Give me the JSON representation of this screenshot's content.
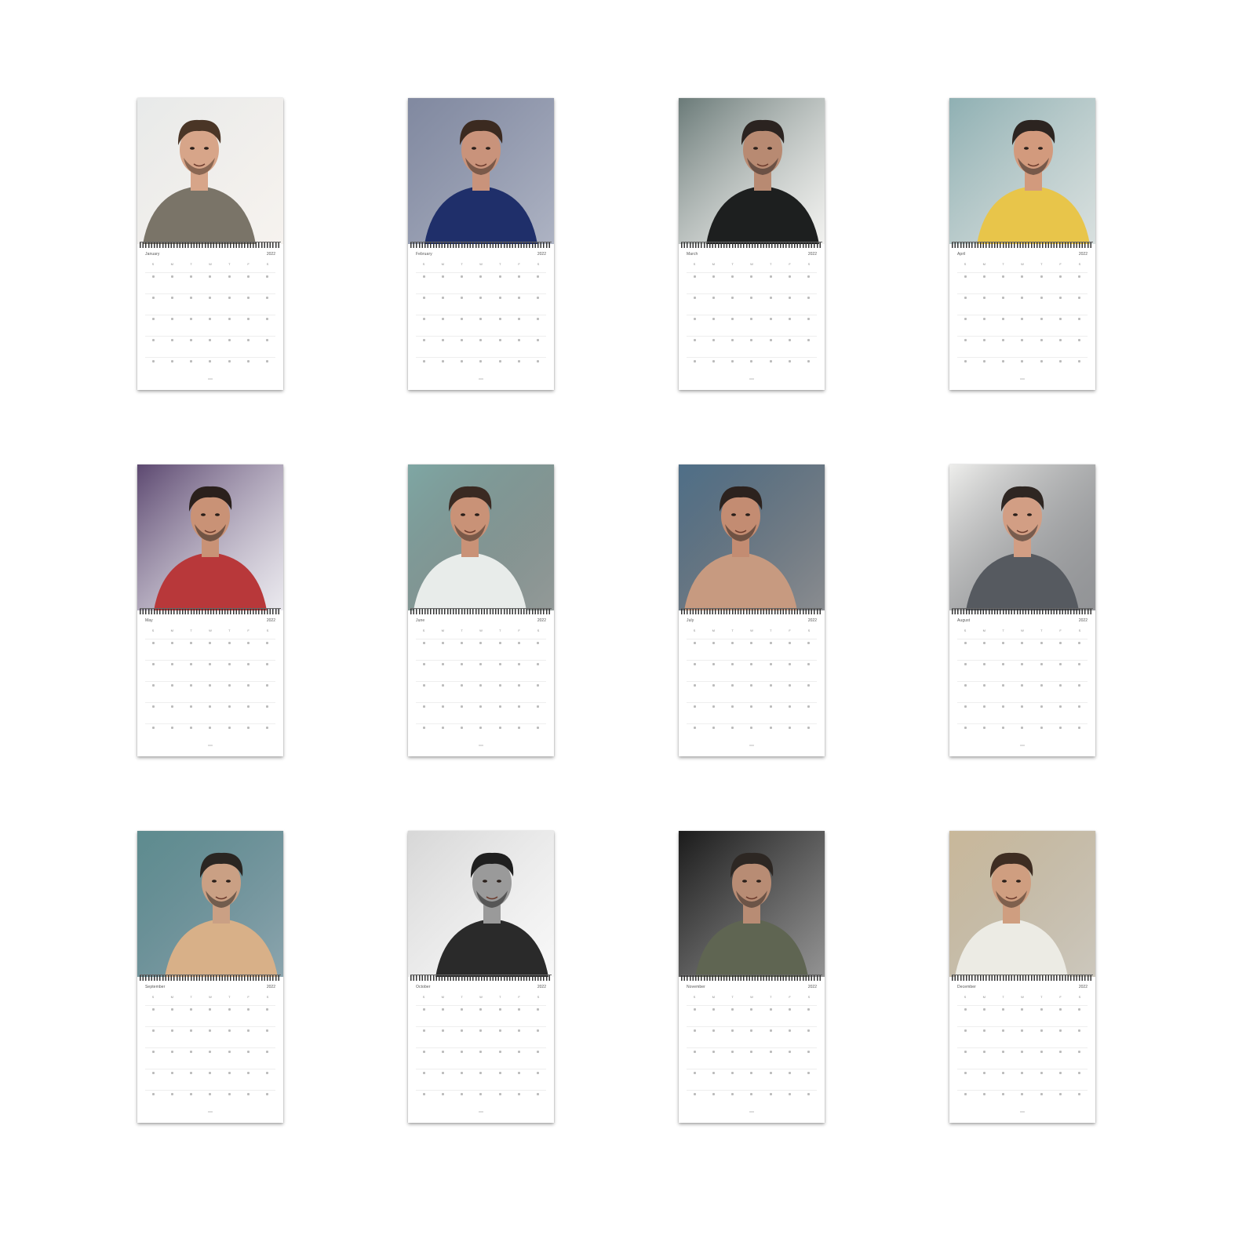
{
  "calendars": [
    {
      "month": "January",
      "year": "2022",
      "photo": {
        "bg": "#e8eaea",
        "shirt": "#7a7468",
        "skin": "#d7a589",
        "hair": "#4a3526",
        "accent": "#efe9e2"
      }
    },
    {
      "month": "February",
      "year": "2022",
      "photo": {
        "bg": "#8189a0",
        "shirt": "#1f2f6a",
        "skin": "#c9937b",
        "hair": "#3b2a20",
        "accent": "#6b7592"
      }
    },
    {
      "month": "March",
      "year": "2022",
      "photo": {
        "bg": "#6a7a78",
        "shirt": "#1d1f1f",
        "skin": "#b88a72",
        "hair": "#2b2320",
        "accent": "#e6e6e2"
      }
    },
    {
      "month": "April",
      "year": "2022",
      "photo": {
        "bg": "#8fb0b3",
        "shirt": "#e8c54a",
        "skin": "#d29a7d",
        "hair": "#2c2420",
        "accent": "#b8c6c4"
      }
    },
    {
      "month": "May",
      "year": "2022",
      "photo": {
        "bg": "#5c4870",
        "shirt": "#b8383a",
        "skin": "#c99276",
        "hair": "#2a201c",
        "accent": "#d9d6e0"
      }
    },
    {
      "month": "June",
      "year": "2022",
      "photo": {
        "bg": "#7fa7a4",
        "shirt": "#e8ecea",
        "skin": "#c99277",
        "hair": "#3a2a22",
        "accent": "#3b4744"
      }
    },
    {
      "month": "July",
      "year": "2022",
      "photo": {
        "bg": "#4f6f88",
        "shirt": "#c79a80",
        "skin": "#c38c72",
        "hair": "#2c221e",
        "accent": "#2a2f36"
      }
    },
    {
      "month": "August",
      "year": "2022",
      "photo": {
        "bg": "#eeeeec",
        "shirt": "#565a60",
        "skin": "#d29e84",
        "hair": "#2e2622",
        "accent": "#3a3d42"
      }
    },
    {
      "month": "September",
      "year": "2022",
      "photo": {
        "bg": "#5e8c8f",
        "shirt": "#d8b088",
        "skin": "#caa084",
        "hair": "#2a2622",
        "accent": "#2e5c6c"
      }
    },
    {
      "month": "October",
      "year": "2022",
      "photo": {
        "bg": "#d7d7d7",
        "shirt": "#2a2a2a",
        "skin": "#9a9a9a",
        "hair": "#1f1f1f",
        "accent": "#f2f2f2"
      }
    },
    {
      "month": "November",
      "year": "2022",
      "photo": {
        "bg": "#1b1b1b",
        "shirt": "#5f6552",
        "skin": "#b88c74",
        "hair": "#2d2723",
        "accent": "#3a3a3a"
      }
    },
    {
      "month": "December",
      "year": "2022",
      "photo": {
        "bg": "#c9b89a",
        "shirt": "#ecebe4",
        "skin": "#cf9e80",
        "hair": "#3e2d22",
        "accent": "#a39a86"
      }
    }
  ],
  "weekday_labels": [
    "S",
    "M",
    "T",
    "W",
    "T",
    "F",
    "S"
  ]
}
